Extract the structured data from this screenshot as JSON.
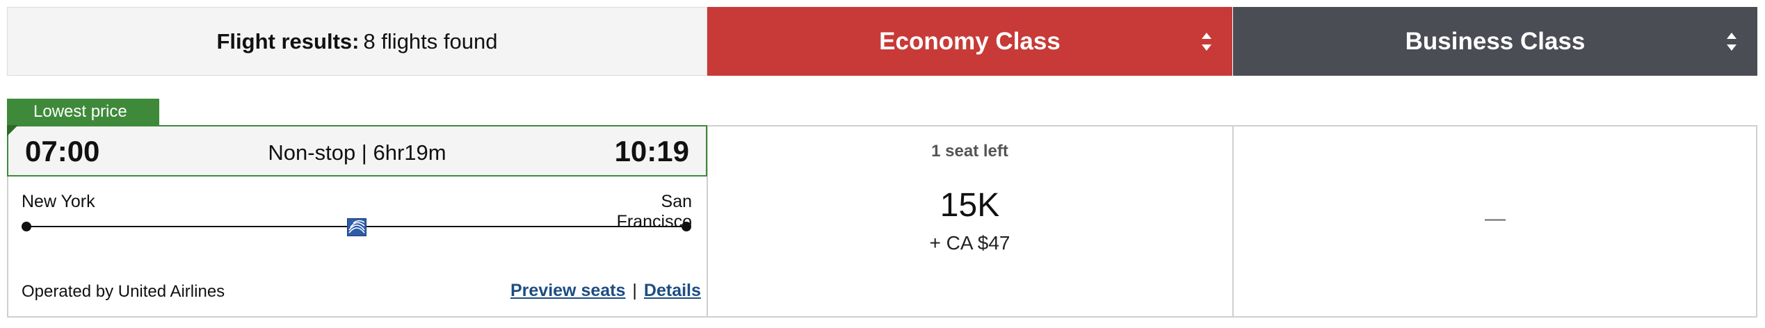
{
  "header": {
    "results_label": "Flight results:",
    "results_count": "8 flights found",
    "economy_label": "Economy Class",
    "business_label": "Business Class"
  },
  "colors": {
    "economy": "#c73a37",
    "business": "#4a4d53",
    "lowest_price": "#3f8a3a",
    "link": "#1d4d82"
  },
  "flight": {
    "badge": "Lowest price",
    "depart_time": "07:00",
    "arrive_time": "10:19",
    "summary": "Non-stop | 6hr19m",
    "origin": "New York",
    "destination": "San Francisco",
    "airline_logo": "united-airlines-globe-icon",
    "operated_by": "Operated by United Airlines",
    "preview_seats": "Preview seats",
    "separator": "|",
    "details": "Details",
    "economy": {
      "seats_left": "1 seat left",
      "miles": "15K",
      "taxes": "+ CA $47"
    },
    "business": {
      "unavailable": "—"
    }
  }
}
